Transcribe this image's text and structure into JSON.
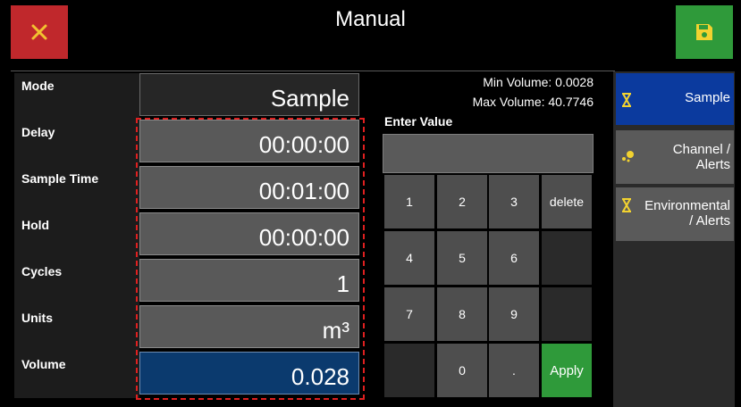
{
  "header": {
    "title": "Manual",
    "close_icon": "close-icon",
    "save_icon": "save-icon",
    "close_color": "#c0282c",
    "save_color": "#2f9a3a"
  },
  "fields": [
    {
      "label": "Mode",
      "value": "Sample"
    },
    {
      "label": "Delay",
      "value": "00:00:00"
    },
    {
      "label": "Sample Time",
      "value": "00:01:00"
    },
    {
      "label": "Hold",
      "value": "00:00:00"
    },
    {
      "label": "Cycles",
      "value": "1"
    },
    {
      "label": "Units",
      "value": "m³"
    },
    {
      "label": "Volume",
      "value": "0.028"
    }
  ],
  "info": {
    "min_volume": "Min Volume: 0.0028",
    "max_volume": "Max Volume: 40.7746",
    "enter_value": "Enter Value",
    "current_input": ""
  },
  "keypad": {
    "k1": "1",
    "k2": "2",
    "k3": "3",
    "delete": "delete",
    "k4": "4",
    "k5": "5",
    "k6": "6",
    "k7": "7",
    "k8": "8",
    "k9": "9",
    "k0": "0",
    "dot": ".",
    "apply": "Apply"
  },
  "side_menu": [
    {
      "label": "Sample",
      "icon": "hourglass-icon",
      "active": true
    },
    {
      "label": "Channel /\nAlerts",
      "icon": "particles-icon",
      "active": false
    },
    {
      "label": "Environmental\n/ Alerts",
      "icon": "hourglass-icon",
      "active": false
    }
  ],
  "colors": {
    "selected_field": "#0b3a6e",
    "active_menu": "#0b3a9e",
    "highlight_dash": "#e02020"
  }
}
